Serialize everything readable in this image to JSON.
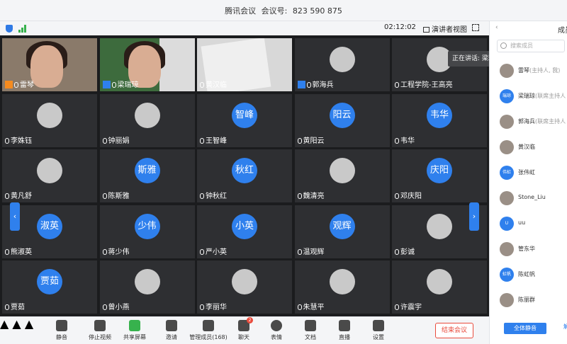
{
  "titlebar": {
    "app": "腾讯会议",
    "meeting_label": "会议号:",
    "meeting_id": "823 590 875"
  },
  "top_toolbar": {
    "time": "02:12:02",
    "view_label": "演讲者视图"
  },
  "speaking_tooltip": "正在讲话: 梁瑞琼; 张伟虹;",
  "tiles": [
    {
      "name": "雷琴",
      "type": "video",
      "host": "orange"
    },
    {
      "name": "梁瑞琼",
      "type": "video",
      "host": "blue"
    },
    {
      "name": "黄汉临",
      "type": "grey"
    },
    {
      "name": "郭海兵",
      "type": "photo",
      "host": "blue"
    },
    {
      "name": "工程学院-王高亮",
      "type": "photo"
    },
    {
      "name": "李姝钰",
      "type": "photo"
    },
    {
      "name": "钟丽娟",
      "type": "photo"
    },
    {
      "name": "王智峰",
      "type": "initial",
      "initial": "智峰"
    },
    {
      "name": "黄阳云",
      "type": "initial",
      "initial": "阳云"
    },
    {
      "name": "韦华",
      "type": "initial",
      "initial": "韦华"
    },
    {
      "name": "黄凡舒",
      "type": "photo"
    },
    {
      "name": "陈斯雅",
      "type": "initial",
      "initial": "斯雅"
    },
    {
      "name": "钟秋红",
      "type": "initial",
      "initial": "秋红"
    },
    {
      "name": "魏清亮",
      "type": "photo"
    },
    {
      "name": "邓庆阳",
      "type": "initial",
      "initial": "庆阳"
    },
    {
      "name": "熊淑英",
      "type": "initial",
      "initial": "淑英"
    },
    {
      "name": "蒋少伟",
      "type": "initial",
      "initial": "少伟"
    },
    {
      "name": "严小英",
      "type": "initial",
      "initial": "小英"
    },
    {
      "name": "温观辉",
      "type": "initial",
      "initial": "观辉"
    },
    {
      "name": "彭诚",
      "type": "photo"
    },
    {
      "name": "贾茹",
      "type": "initial",
      "initial": "贾茹"
    },
    {
      "name": "曾小燕",
      "type": "photo"
    },
    {
      "name": "李丽华",
      "type": "photo"
    },
    {
      "name": "朱慧平",
      "type": "photo"
    },
    {
      "name": "许震宇",
      "type": "photo"
    }
  ],
  "bottom_toolbar": {
    "mute": "静音",
    "stop_video": "停止视频",
    "share": "共享屏幕",
    "invite": "邀请",
    "manage_members": "管理成员(168)",
    "chat": "聊天",
    "chat_badge": "2",
    "reactions": "表情",
    "docs": "文档",
    "live": "直播",
    "settings": "设置",
    "end": "结束会议"
  },
  "panel": {
    "title": "成员",
    "search_placeholder": "搜索成员",
    "members": [
      {
        "avatar": "",
        "name": "雷琴",
        "role": "(主持人, 我)"
      },
      {
        "avatar": "瑞琼",
        "name": "梁瑞琼",
        "role": "(联席主持人"
      },
      {
        "avatar": "",
        "name": "郭海兵",
        "role": "(联席主持人"
      },
      {
        "avatar": "",
        "name": "黄汉临",
        "role": ""
      },
      {
        "avatar": "伟虹",
        "name": "张伟虹",
        "role": ""
      },
      {
        "avatar": "",
        "name": "Stone_Liu",
        "role": ""
      },
      {
        "avatar": "U",
        "name": "uu",
        "role": ""
      },
      {
        "avatar": "",
        "name": "管东华",
        "role": ""
      },
      {
        "avatar": "虹帆",
        "name": "陈虹帆",
        "role": ""
      },
      {
        "avatar": "",
        "name": "陈丽群",
        "role": ""
      }
    ],
    "mute_all": "全体静音",
    "more_label": "解"
  }
}
